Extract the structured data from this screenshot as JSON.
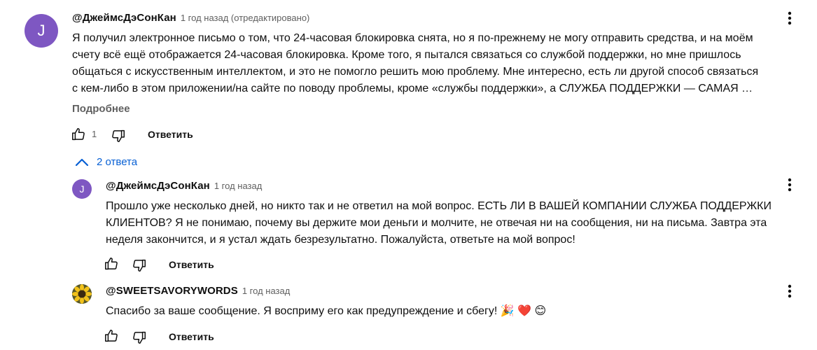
{
  "comment": {
    "avatar_letter": "J",
    "author": "@ДжеймсДэСонКан",
    "time": "1 год назад (отредактировано)",
    "lines": [
      "Я получил электронное письмо о том, что 24-часовая блокировка снята, но я по-прежнему не могу отправить средства, и на моём",
      "счету всё ещё отображается 24-часовая блокировка. Кроме того, я пытался связаться со службой поддержки, но мне пришлось",
      "общаться с искусственным интеллектом, и это не помогло решить мою проблему. Мне интересно, есть ли другой способ связаться",
      "с кем-либо в этом приложении/на сайте по поводу проблемы, кроме «службы поддержки», а СЛУЖБА ПОДДЕРЖКИ — САМАЯ …"
    ],
    "read_more": "Подробнее",
    "likes": "1",
    "reply_label": "Ответить"
  },
  "replies_toggle": "2 ответа",
  "replies": [
    {
      "avatar_letter": "J",
      "author": "@ДжеймсДэСонКан",
      "time": "1 год назад",
      "lines": [
        "Прошло уже несколько дней, но никто так и не ответил на мой вопрос. ЕСТЬ ЛИ В ВАШЕЙ КОМПАНИИ СЛУЖБА ПОДДЕРЖКИ",
        "КЛИЕНТОВ? Я не понимаю, почему вы держите мои деньги и молчите, не отвечая ни на сообщения, ни на письма. Завтра эта",
        "неделя закончится, и я устал ждать безрезультатно.  Пожалуйста, ответьте на мой вопрос!"
      ],
      "reply_label": "Ответить"
    },
    {
      "author": "@SWEETSAVORYWORDS",
      "time": "1 год назад",
      "lines": [
        "Спасибо за ваше сообщение. Я восприму его как предупреждение и сбегу! 🎉 ❤️ 😊"
      ],
      "reply_label": "Ответить"
    }
  ],
  "colors": {
    "avatar": "#7e57c2",
    "link": "#065fd4",
    "secondary_text": "#606060"
  }
}
